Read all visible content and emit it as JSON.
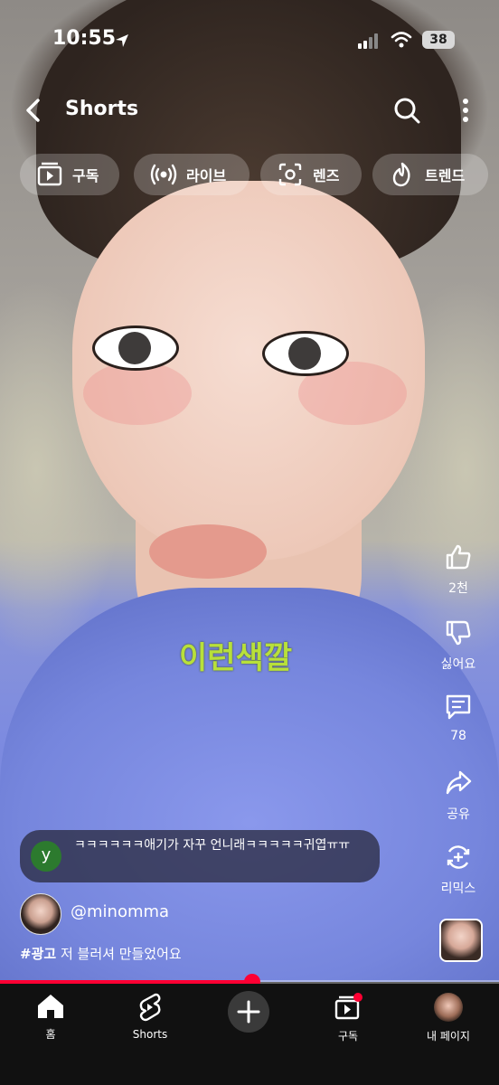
{
  "status": {
    "time": "10:55",
    "battery": "38"
  },
  "header": {
    "title": "Shorts"
  },
  "chips": [
    {
      "label": "구독",
      "icon": "subscriptions-icon"
    },
    {
      "label": "라이브",
      "icon": "live-icon"
    },
    {
      "label": "렌즈",
      "icon": "lens-icon"
    },
    {
      "label": "트렌드",
      "icon": "trend-icon"
    }
  ],
  "video": {
    "caption": "이런색깔"
  },
  "actions": {
    "like": "2천",
    "dislike": "싫어요",
    "comments": "78",
    "share": "공유",
    "remix": "리믹스"
  },
  "comment": {
    "avatar_letter": "y",
    "text": "ㅋㅋㅋㅋㅋㅋ애기가 자꾸 언니래ㅋㅋㅋㅋㅋ귀엽ㅠㅠ"
  },
  "channel": {
    "handle": "@minomma"
  },
  "description": {
    "hashtag": "#광고",
    "text": "저 블러셔 만들었어요"
  },
  "progress": 0.505,
  "nav": {
    "home": "홈",
    "shorts": "Shorts",
    "subscriptions": "구독",
    "mypage": "내 페이지"
  },
  "colors": {
    "accent": "#ff0033",
    "caption": "#b8e03a"
  }
}
